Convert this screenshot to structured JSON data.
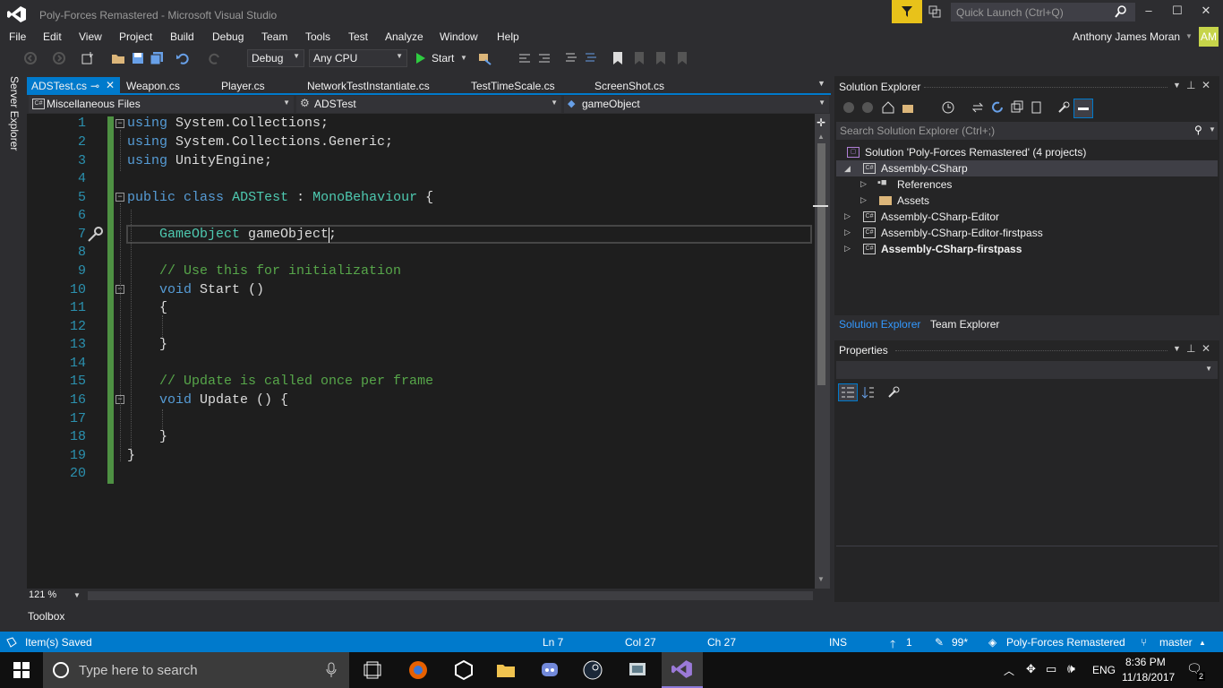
{
  "window": {
    "title": "Poly-Forces Remastered - Microsoft Visual Studio",
    "quick_launch_placeholder": "Quick Launch (Ctrl+Q)",
    "minimize": "–",
    "maximize": "☐",
    "close": "✕"
  },
  "menu": [
    "File",
    "Edit",
    "View",
    "Project",
    "Build",
    "Debug",
    "Team",
    "Tools",
    "Test",
    "Analyze",
    "Window",
    "Help"
  ],
  "user": {
    "name": "Anthony James Moran",
    "initials": "AM"
  },
  "toolbar": {
    "config": "Debug",
    "platform": "Any CPU",
    "start_label": "Start"
  },
  "left_strip": {
    "server_explorer": "Server Explorer"
  },
  "tabs": [
    {
      "label": "ADSTest.cs",
      "active": true
    },
    {
      "label": "Weapon.cs"
    },
    {
      "label": "Player.cs"
    },
    {
      "label": "NetworkTestInstantiate.cs"
    },
    {
      "label": "TestTimeScale.cs"
    },
    {
      "label": "ScreenShot.cs"
    }
  ],
  "navbar": {
    "project": "Miscellaneous Files",
    "class": "ADSTest",
    "member": "gameObject"
  },
  "code": {
    "line_numbers": [
      "1",
      "2",
      "3",
      "4",
      "5",
      "6",
      "7",
      "8",
      "9",
      "10",
      "11",
      "12",
      "13",
      "14",
      "15",
      "16",
      "17",
      "18",
      "19",
      "20"
    ]
  },
  "zoom": "121 %",
  "toolbox_label": "Toolbox",
  "solution_explorer": {
    "title": "Solution Explorer",
    "search_placeholder": "Search Solution Explorer (Ctrl+;)",
    "root": "Solution 'Poly-Forces Remastered' (4 projects)",
    "items": [
      {
        "label": "Assembly-CSharp"
      },
      {
        "label": "References"
      },
      {
        "label": "Assets"
      },
      {
        "label": "Assembly-CSharp-Editor"
      },
      {
        "label": "Assembly-CSharp-Editor-firstpass"
      },
      {
        "label": "Assembly-CSharp-firstpass"
      }
    ],
    "tab_solution": "Solution Explorer",
    "tab_team": "Team Explorer"
  },
  "properties": {
    "title": "Properties"
  },
  "status": {
    "message": "Item(s) Saved",
    "ln": "Ln 7",
    "col": "Col 27",
    "ch": "Ch 27",
    "ins": "INS",
    "up": "1",
    "pending": "99*",
    "repo": "Poly-Forces Remastered",
    "branch": "master"
  },
  "taskbar": {
    "search_placeholder": "Type here to search",
    "lang": "ENG",
    "time": "8:36 PM",
    "date": "11/18/2017"
  }
}
